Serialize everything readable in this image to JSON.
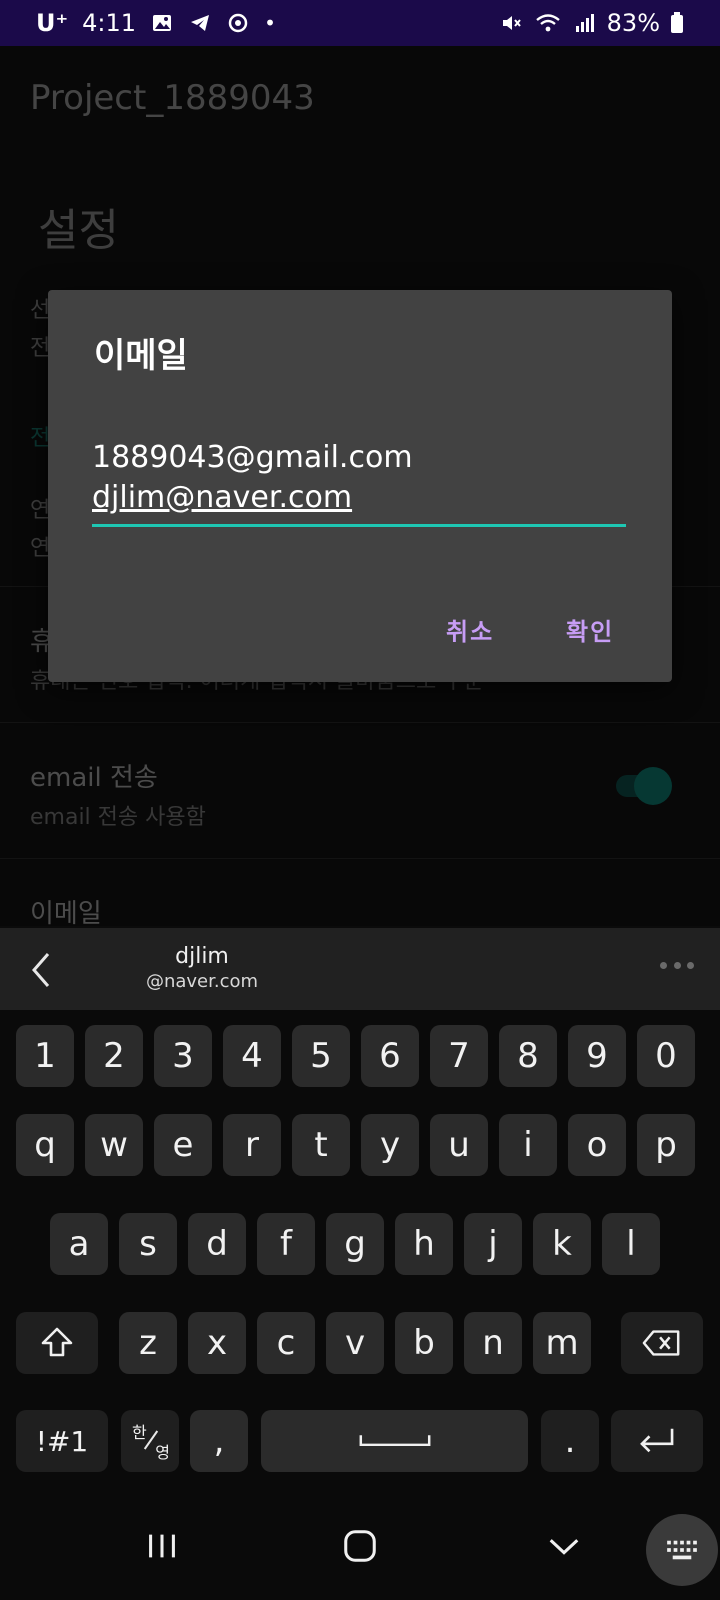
{
  "status_bar": {
    "carrier": "U⁺",
    "time": "4:11",
    "dot": "•",
    "battery": "83%"
  },
  "app": {
    "title": "Project_1889043",
    "section_title": "설정",
    "stubs": [
      "선",
      "전",
      "전",
      "연",
      "연",
      "휴"
    ],
    "phone_pref": {
      "summary": "휴대폰 번호 입력. 여러개 입력시 줄바꿈으로 구분"
    },
    "email_pref": {
      "title": "email 전송",
      "summary": "email 전송 사용함",
      "enabled": true
    },
    "email_list_pref": {
      "title": "이메일"
    },
    "accent_color": "#0f7c72"
  },
  "dialog": {
    "title": "이메일",
    "lines": [
      "1889043@gmail.com",
      "djlim@naver.com"
    ],
    "cancel_label": "취소",
    "ok_label": "확인",
    "button_color": "#c79df5",
    "underline_color": "#1ec7b3"
  },
  "keyboard": {
    "suggestion_line1": "djlim",
    "suggestion_line2": "@naver.com",
    "row_numbers": [
      "1",
      "2",
      "3",
      "4",
      "5",
      "6",
      "7",
      "8",
      "9",
      "0"
    ],
    "row_q": [
      "q",
      "w",
      "e",
      "r",
      "t",
      "y",
      "u",
      "i",
      "o",
      "p"
    ],
    "row_a": [
      "a",
      "s",
      "d",
      "f",
      "g",
      "h",
      "j",
      "k",
      "l"
    ],
    "row_z": [
      "z",
      "x",
      "c",
      "v",
      "b",
      "n",
      "m"
    ],
    "symbols_label": "!#1",
    "lang_top": "한",
    "lang_bottom": "영",
    "comma": ",",
    "period": ".",
    "icons": [
      "back-arrow-icon",
      "more-dots-icon",
      "shift-icon",
      "backspace-icon",
      "space-icon",
      "enter-icon"
    ]
  },
  "nav_bar": {
    "icons": [
      "recent-apps-icon",
      "home-icon",
      "back-chevron-icon",
      "keyboard-icon"
    ]
  }
}
